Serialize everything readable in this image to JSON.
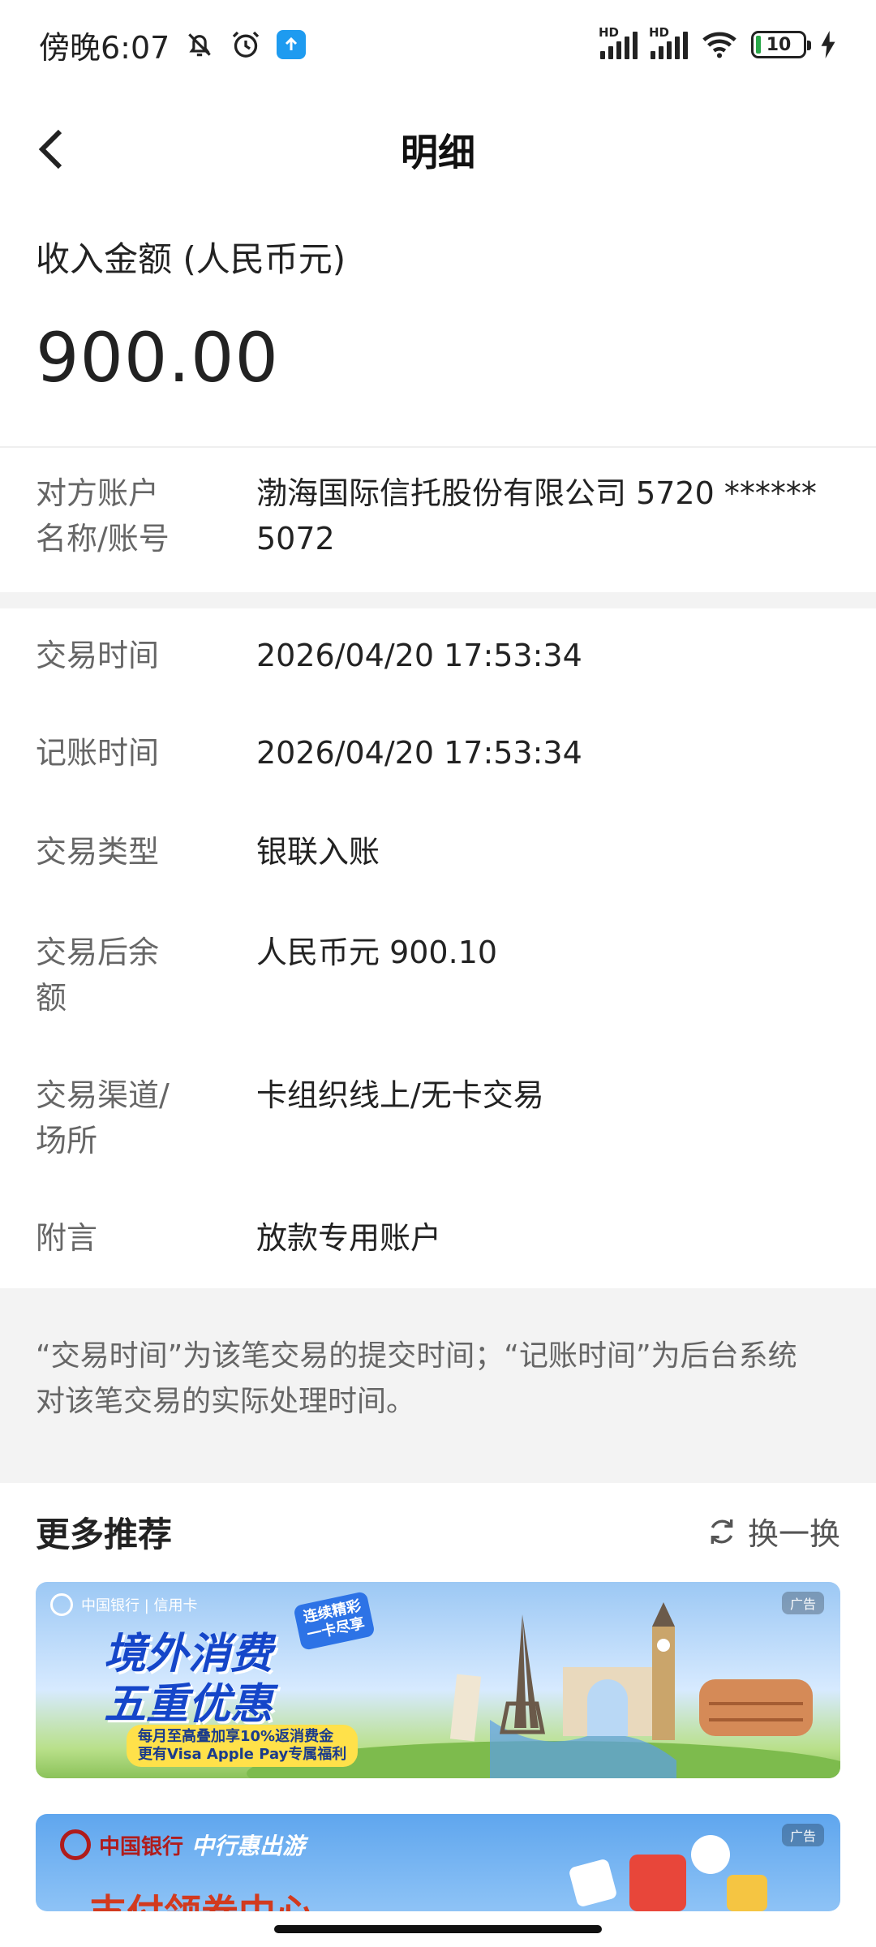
{
  "status_bar": {
    "time": "傍晚6:07",
    "battery": "10",
    "hd": "HD"
  },
  "nav": {
    "title": "明细"
  },
  "amount": {
    "label": "收入金额 (人民币元)",
    "value": "900.00"
  },
  "counterparty": {
    "label_line1": "对方账户",
    "label_line2": "名称/账号",
    "value_line1": "渤海国际信托股份有限公司 5720 ******",
    "value_line2": "5072"
  },
  "details": [
    {
      "label": "交易时间",
      "value": "2026/04/20 17:53:34"
    },
    {
      "label": "记账时间",
      "value": "2026/04/20 17:53:34"
    },
    {
      "label": "交易类型",
      "value": "银联入账"
    },
    {
      "label_line1": "交易后余",
      "label_line2": "额",
      "value": "人民币元 900.10"
    },
    {
      "label_line1": "交易渠道/",
      "label_line2": "场所",
      "value": "卡组织线上/无卡交易"
    },
    {
      "label": "附言",
      "value": "放款专用账户"
    }
  ],
  "note": {
    "line1": "“交易时间”为该笔交易的提交时间；“记账时间”为后台系统",
    "line2": "对该笔交易的实际处理时间。"
  },
  "more": {
    "title": "更多推荐",
    "refresh_label": "换一换"
  },
  "banners": [
    {
      "ad_tag": "广告",
      "logo_text": "中国银行 | 信用卡",
      "headline_line1": "境外消费",
      "headline_line2": "五重优惠",
      "sticker_line1": "连续精彩",
      "sticker_line2": "一卡尽享",
      "sub_line1": "每月至高叠加享10%返消费金",
      "sub_line2": "更有Visa Apple Pay专属福利"
    },
    {
      "ad_tag": "广告",
      "logo_text": "中国银行",
      "brand": "中行惠出游",
      "headline": "支付领券中心"
    }
  ],
  "colors": {
    "accent_blue": "#1546c9",
    "text_primary": "#222222",
    "text_secondary": "#666666",
    "band_gray": "#f3f3f3"
  }
}
